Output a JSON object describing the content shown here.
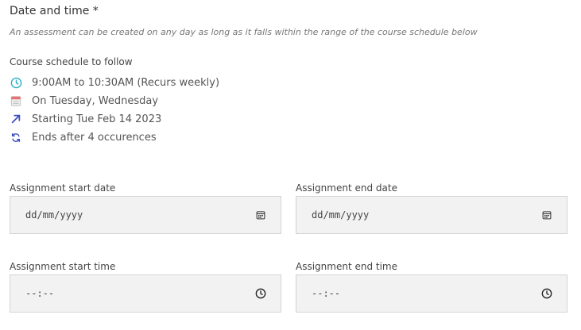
{
  "section": {
    "title": "Date and time *",
    "subtitle": "An assessment can be created on any day as long as it falls within the range of the course schedule below"
  },
  "schedule": {
    "label": "Course schedule to follow",
    "items": [
      {
        "icon": "clock-icon",
        "text": "9:00AM to 10:30AM (Recurs weekly)",
        "color": "#2ab0c5"
      },
      {
        "icon": "calendar-icon",
        "text": "On Tuesday, Wednesday",
        "color": "#e57373"
      },
      {
        "icon": "arrow-up-right-icon",
        "text": "Starting Tue Feb 14 2023",
        "color": "#3b4cc0"
      },
      {
        "icon": "repeat-icon",
        "text": "Ends after 4 occurences",
        "color": "#3b4cc0"
      }
    ]
  },
  "fields": {
    "start_date": {
      "label": "Assignment start date",
      "value": "dd/mm/yyyy",
      "icon": "calendar-icon"
    },
    "end_date": {
      "label": "Assignment end date",
      "value": "dd/mm/yyyy",
      "icon": "calendar-icon"
    },
    "start_time": {
      "label": "Assignment start time",
      "value": "--:--",
      "icon": "clock-icon"
    },
    "end_time": {
      "label": "Assignment end time",
      "value": "--:--",
      "icon": "clock-icon"
    }
  }
}
